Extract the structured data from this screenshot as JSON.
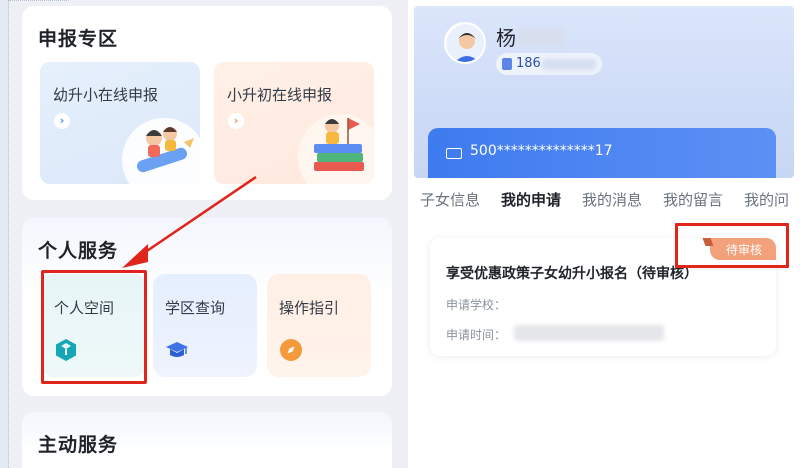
{
  "left": {
    "apply_section": {
      "title": "申报专区",
      "tiles": [
        {
          "label": "幼升小在线申报",
          "arrow": "›"
        },
        {
          "label": "小升初在线申报",
          "arrow": "›"
        }
      ]
    },
    "personal_section": {
      "title": "个人服务",
      "tiles": [
        {
          "label": "个人空间",
          "icon": "cube-icon"
        },
        {
          "label": "学区查询",
          "icon": "graduation-cap-icon"
        },
        {
          "label": "操作指引",
          "icon": "compass-icon"
        }
      ]
    },
    "active_section": {
      "title": "主动服务"
    }
  },
  "right": {
    "profile": {
      "name": "杨",
      "phone": "186",
      "id_number": "500**************17"
    },
    "tabs": [
      {
        "label": "子女信息",
        "active": false
      },
      {
        "label": "我的申请",
        "active": true
      },
      {
        "label": "我的消息",
        "active": false
      },
      {
        "label": "我的留言",
        "active": false
      },
      {
        "label": "我的问",
        "active": false
      }
    ],
    "application": {
      "title": "享受优惠政策子女幼升小报名（待审核）",
      "status": "待审核",
      "school_label": "申请学校：",
      "time_label": "申请时间："
    }
  },
  "colors": {
    "highlight_red": "#e0261c",
    "accent_blue": "#3e7bf0",
    "badge_orange": "#f2a17b"
  }
}
